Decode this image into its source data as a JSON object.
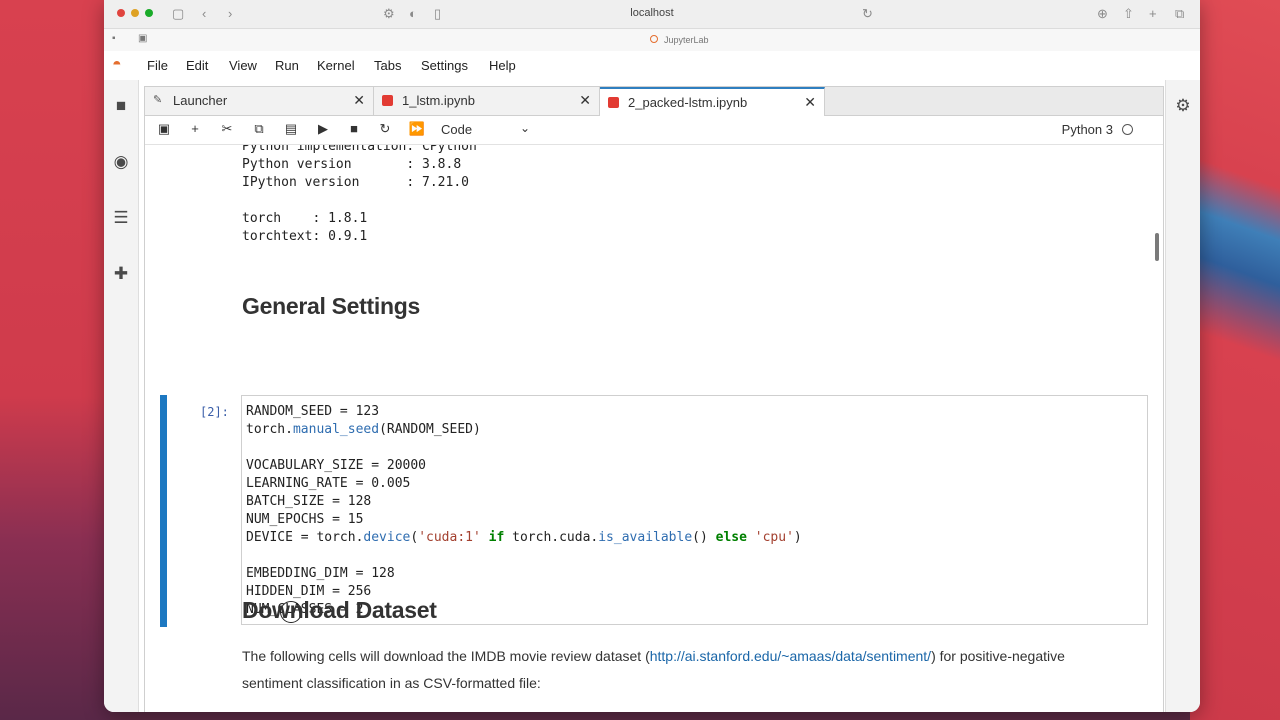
{
  "browser": {
    "url": "localhost",
    "page_title": "JupyterLab"
  },
  "menu": {
    "items": [
      "File",
      "Edit",
      "View",
      "Run",
      "Kernel",
      "Tabs",
      "Settings",
      "Help"
    ]
  },
  "tabs": [
    {
      "label": "Launcher",
      "icon": "launcher-icon",
      "active": false
    },
    {
      "label": "1_lstm.ipynb",
      "icon": "notebook-icon",
      "active": false
    },
    {
      "label": "2_packed-lstm.ipynb",
      "icon": "notebook-icon",
      "active": true
    }
  ],
  "toolbar": {
    "cell_type": "Code",
    "kernel_name": "Python 3"
  },
  "output_lines": [
    "Python implementation: CPython",
    "Python version       : 3.8.8",
    "IPython version      : 7.21.0",
    "",
    "torch    : 1.8.1",
    "torchtext: 0.9.1"
  ],
  "headings": {
    "general_settings": "General Settings",
    "download_dataset": "Download Dataset"
  },
  "code_cell": {
    "prompt": "[2]:",
    "lines": {
      "l1": "RANDOM_SEED = 123",
      "l2_obj": "torch.",
      "l2_fn": "manual_seed",
      "l2_rest": "(RANDOM_SEED)",
      "l3": "VOCABULARY_SIZE = 20000",
      "l4": "LEARNING_RATE = 0.005",
      "l5": "BATCH_SIZE = 128",
      "l6": "NUM_EPOCHS = 15",
      "l7_a": "DEVICE = torch.",
      "l7_fn": "device",
      "l7_b": "(",
      "l7_str1": "'cuda:1'",
      "l7_kw1": " if ",
      "l7_c": "torch.cuda.",
      "l7_fn2": "is_available",
      "l7_d": "() ",
      "l7_kw2": "else",
      "l7_str2": " 'cpu'",
      "l7_e": ")",
      "l8": "EMBEDDING_DIM = 128",
      "l9": "HIDDEN_DIM = 256",
      "l10": "NUM_CLASSES = 2"
    }
  },
  "markdown": {
    "before_link": "The following cells will download the IMDB movie review dataset (",
    "link": "http://ai.stanford.edu/~amaas/data/sentiment/",
    "after_link": ") for positive-negative sentiment classification in as CSV-formatted file:"
  },
  "colors": {
    "accent": "#1d78c1",
    "notebook_icon": "#e23b33",
    "link": "#1a66a8"
  }
}
